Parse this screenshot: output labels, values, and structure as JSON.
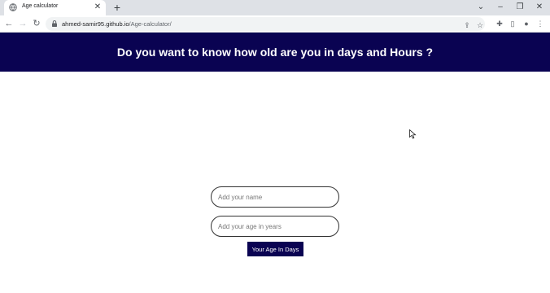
{
  "browser": {
    "tab_title": "Age calculator",
    "tab_close": "✕",
    "new_tab": "+",
    "url_host": "ahmed-samir95.github.io",
    "url_path": "/Age-calculator/"
  },
  "page": {
    "header_title": "Do you want to know how old are you in days and Hours ?",
    "header_bg": "#0a0352",
    "name_placeholder": "Add your name",
    "age_placeholder": "Add your age in years",
    "submit_label": "Your Age In Days"
  }
}
